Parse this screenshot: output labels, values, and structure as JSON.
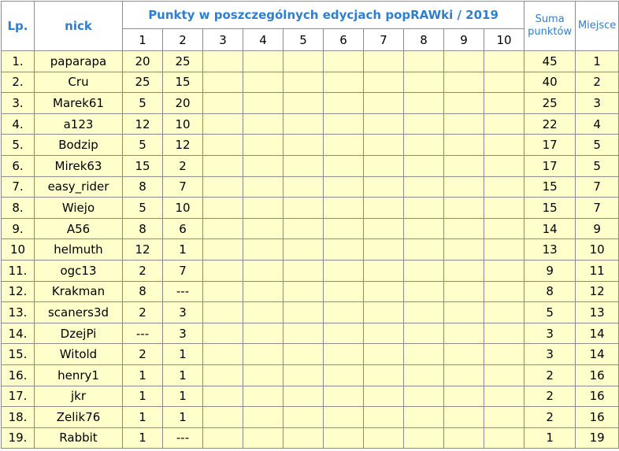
{
  "header": {
    "lp": "Lp.",
    "nick": "nick",
    "editions_title": "Punkty w poszczególnych edycjach popRAWki / 2019",
    "sum_line1": "Suma",
    "sum_line2": "punktów",
    "place": "Miejsce",
    "editions": [
      "1",
      "2",
      "3",
      "4",
      "5",
      "6",
      "7",
      "8",
      "9",
      "10"
    ]
  },
  "rows": [
    {
      "lp": "1.",
      "nick": "paparapa",
      "e1": "20",
      "e2": "25",
      "sum": "45",
      "place": "1"
    },
    {
      "lp": "2.",
      "nick": "Cru",
      "e1": "25",
      "e2": "15",
      "sum": "40",
      "place": "2"
    },
    {
      "lp": "3.",
      "nick": "Marek61",
      "e1": "5",
      "e2": "20",
      "sum": "25",
      "place": "3"
    },
    {
      "lp": "4.",
      "nick": "a123",
      "e1": "12",
      "e2": "10",
      "sum": "22",
      "place": "4"
    },
    {
      "lp": "5.",
      "nick": "Bodzip",
      "e1": "5",
      "e2": "12",
      "sum": "17",
      "place": "5"
    },
    {
      "lp": "6.",
      "nick": "Mirek63",
      "e1": "15",
      "e2": "2",
      "sum": "17",
      "place": "5"
    },
    {
      "lp": "7.",
      "nick": "easy_rider",
      "e1": "8",
      "e2": "7",
      "sum": "15",
      "place": "7"
    },
    {
      "lp": "8.",
      "nick": "Wiejo",
      "e1": "5",
      "e2": "10",
      "sum": "15",
      "place": "7"
    },
    {
      "lp": "9.",
      "nick": "A56",
      "e1": "8",
      "e2": "6",
      "sum": "14",
      "place": "9"
    },
    {
      "lp": "10",
      "nick": "helmuth",
      "e1": "12",
      "e2": "1",
      "sum": "13",
      "place": "10"
    },
    {
      "lp": "11.",
      "nick": "ogc13",
      "e1": "2",
      "e2": "7",
      "sum": "9",
      "place": "11"
    },
    {
      "lp": "12.",
      "nick": "Krakman",
      "e1": "8",
      "e2": "---",
      "sum": "8",
      "place": "12"
    },
    {
      "lp": "13.",
      "nick": "scaners3d",
      "e1": "2",
      "e2": "3",
      "sum": "5",
      "place": "13"
    },
    {
      "lp": "14.",
      "nick": "DzejPi",
      "e1": "---",
      "e2": "3",
      "sum": "3",
      "place": "14"
    },
    {
      "lp": "15.",
      "nick": "Witold",
      "e1": "2",
      "e2": "1",
      "sum": "3",
      "place": "14"
    },
    {
      "lp": "16.",
      "nick": "henry1",
      "e1": "1",
      "e2": "1",
      "sum": "2",
      "place": "16"
    },
    {
      "lp": "17.",
      "nick": "jkr",
      "e1": "1",
      "e2": "1",
      "sum": "2",
      "place": "16"
    },
    {
      "lp": "18.",
      "nick": "Zelik76",
      "e1": "1",
      "e2": "1",
      "sum": "2",
      "place": "16"
    },
    {
      "lp": "19.",
      "nick": "Rabbit",
      "e1": "1",
      "e2": "---",
      "sum": "1",
      "place": "19"
    }
  ]
}
